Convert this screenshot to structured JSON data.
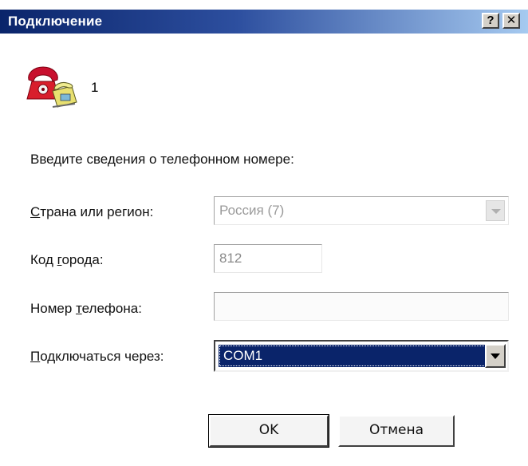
{
  "window": {
    "title": "Подключение",
    "help_button": "?",
    "close_button": "✕"
  },
  "entry": {
    "name": "1",
    "icon": "phone-icon"
  },
  "prompt": "Введите сведения о телефонном номере:",
  "country": {
    "label_first": "С",
    "label_rest": "трана или регион:",
    "value": "Россия (7)",
    "disabled": true
  },
  "area_code": {
    "label_pre": "Код ",
    "label_u": "г",
    "label_rest": "орода:",
    "value": "812"
  },
  "phone_number": {
    "label_pre": "Номер ",
    "label_u": "т",
    "label_rest": "елефона:",
    "value": ""
  },
  "connect_using": {
    "label_first": "П",
    "label_rest": "одключаться через:",
    "value": "COM1"
  },
  "buttons": {
    "ok": "OK",
    "cancel": "Отмена"
  },
  "colors": {
    "titlebar_start": "#0a246a",
    "titlebar_end": "#a6caf0",
    "selection": "#0a246a"
  }
}
